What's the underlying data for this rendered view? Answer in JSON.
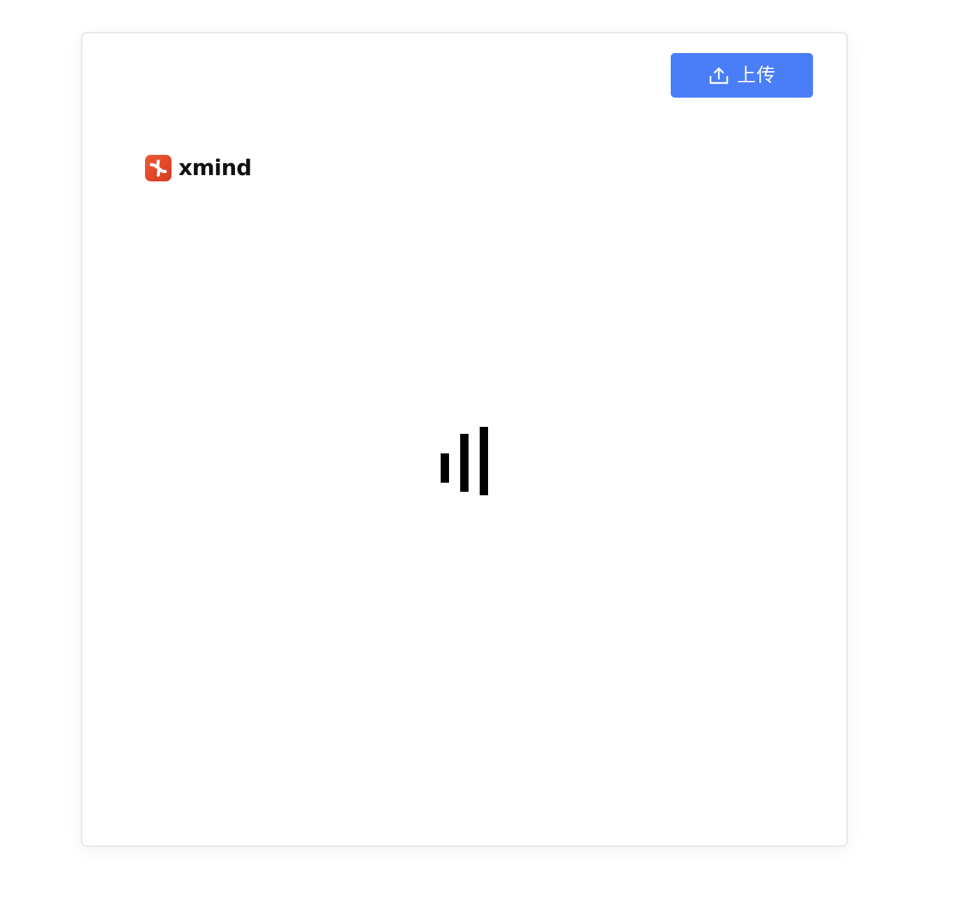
{
  "toolbar": {
    "upload_label": "上传",
    "upload_icon": "upload-icon",
    "upload_color": "#497ef8"
  },
  "logo": {
    "wordmark": "xmind",
    "icon": "xmind-logo-icon",
    "brand_color": "#e44a2a"
  },
  "loader": {
    "icon": "loading-bars-icon",
    "bar_count": 3
  }
}
